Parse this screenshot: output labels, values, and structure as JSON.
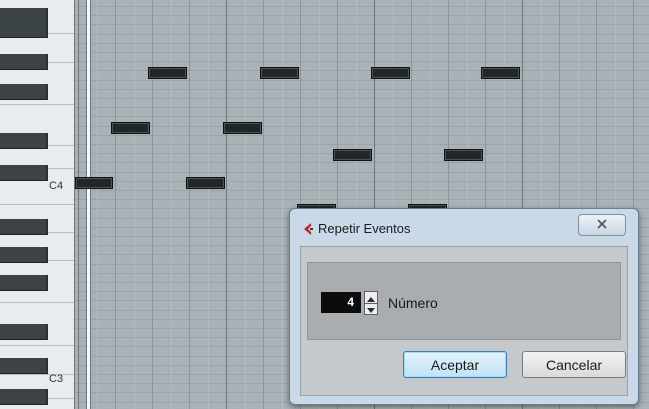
{
  "piano": {
    "labels": [
      {
        "text": "C4",
        "row": "c4"
      },
      {
        "text": "C3",
        "row": "c3"
      }
    ]
  },
  "dialog": {
    "title": "Repetir Eventos",
    "icon": "cubase-logo-icon",
    "close_icon": "close-icon",
    "number_label": "Número",
    "number_value": "4",
    "ok_label": "Aceptar",
    "cancel_label": "Cancelar"
  },
  "colors": {
    "note_fill": "#222629",
    "logo_red": "#c8202a",
    "ok_border": "#3c7fb1"
  }
}
